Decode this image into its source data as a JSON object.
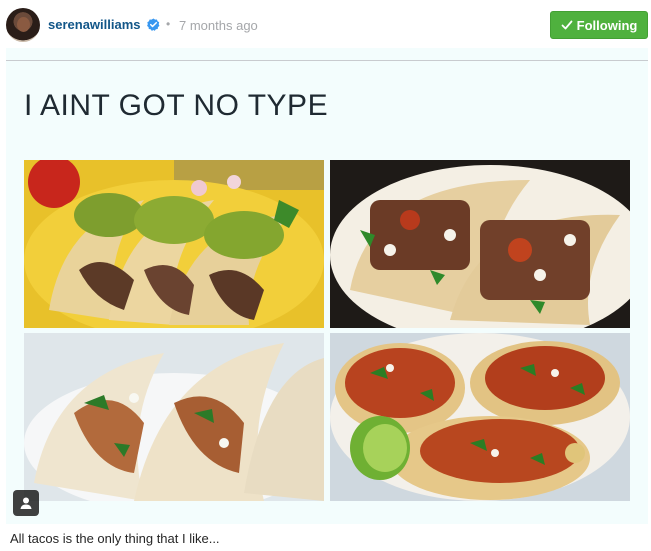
{
  "header": {
    "username": "serenawilliams",
    "separator": "•",
    "timestamp": "7 months ago",
    "follow_label": "Following",
    "accent": "#125688",
    "follow_color": "#4fb13e"
  },
  "photo": {
    "meme_text": "I AINT GOT NO TYPE",
    "tiles": [
      "tacos-guacamole",
      "tacos-carne-asada",
      "tacos-chicken",
      "tacos-pastor-lime"
    ]
  },
  "icons": {
    "verified": "verified-badge-icon",
    "check": "check-icon",
    "user_tag": "user-tag-icon"
  },
  "caption": {
    "text": "All tacos is the only thing that I like..."
  }
}
